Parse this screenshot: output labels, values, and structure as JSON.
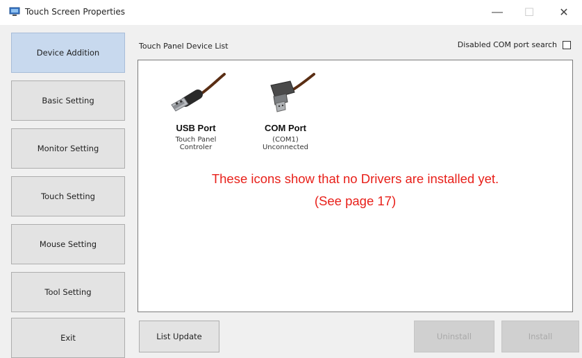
{
  "window": {
    "title": "Touch Screen Properties",
    "minimize_glyph": "—",
    "maximize_glyph": "☐",
    "close_glyph": "✕"
  },
  "nav": {
    "items": [
      {
        "label": "Device Addition",
        "active": true
      },
      {
        "label": "Basic Setting",
        "active": false
      },
      {
        "label": "Monitor Setting",
        "active": false
      },
      {
        "label": "Touch Setting",
        "active": false
      },
      {
        "label": "Mouse Setting",
        "active": false
      },
      {
        "label": "Tool Setting",
        "active": false
      },
      {
        "label": "Exit",
        "active": false
      }
    ]
  },
  "panel": {
    "title": "Touch Panel Device List",
    "disabled_com_search_label": "Disabled COM port search",
    "disabled_com_search_checked": false
  },
  "devices": [
    {
      "icon": "usb-plug-icon",
      "name": "USB Port",
      "line1": "Touch Panel",
      "line2": "Controler"
    },
    {
      "icon": "com-plug-icon",
      "name": "COM Port",
      "line1": "(COM1)",
      "line2": "Unconnected"
    }
  ],
  "note": {
    "line1": "These icons show that no Drivers are installed yet.",
    "line2": "(See page 17)",
    "color": "#e8201a"
  },
  "buttons": {
    "list_update": "List Update",
    "uninstall": "Uninstall",
    "install": "Install"
  },
  "colors": {
    "active_nav": "#c8d9ee",
    "disabled_button": "#d0d0d0"
  }
}
